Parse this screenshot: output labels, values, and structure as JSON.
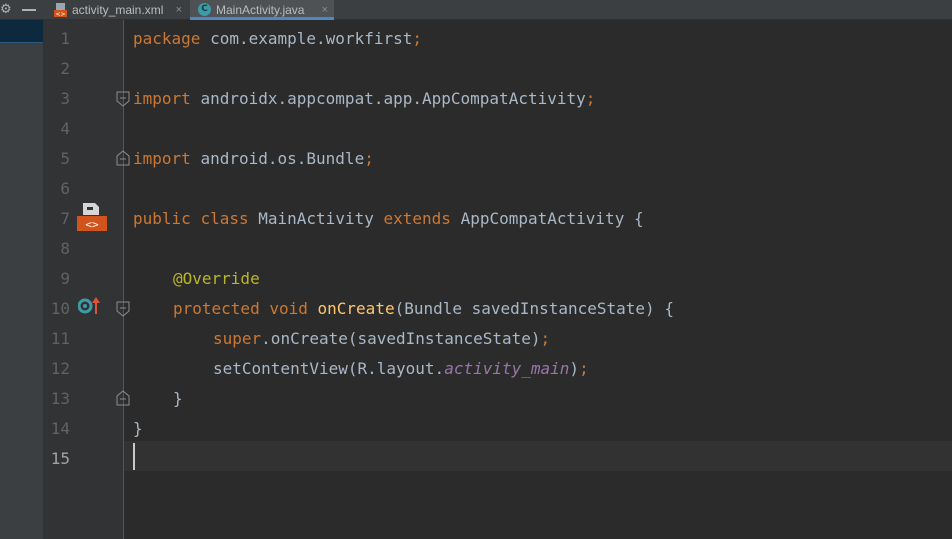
{
  "tabs": [
    {
      "label": "activity_main.xml",
      "icon": "xml-layout-file-icon",
      "active": false
    },
    {
      "label": "MainActivity.java",
      "icon": "java-class-file-icon",
      "active": true
    }
  ],
  "tab_close_glyph": "×",
  "line_numbers": [
    "1",
    "2",
    "3",
    "4",
    "5",
    "6",
    "7",
    "8",
    "9",
    "10",
    "11",
    "12",
    "13",
    "14",
    "15"
  ],
  "current_line": 15,
  "code": {
    "l1": {
      "kw": "package",
      "rest": "com.example.workfirst",
      "semi": ";"
    },
    "l3": {
      "kw": "import",
      "rest": "androidx.appcompat.app.AppCompatActivity",
      "semi": ";"
    },
    "l5": {
      "kw": "import",
      "rest": "android.os.Bundle",
      "semi": ";"
    },
    "l7": {
      "kw1": "public",
      "kw2": "class",
      "name": "MainActivity",
      "kw3": "extends",
      "parent": "AppCompatActivity",
      "brace": "{"
    },
    "l9": {
      "annotation": "@Override"
    },
    "l10": {
      "kw1": "protected",
      "kw2": "void",
      "method": "onCreate",
      "params": "(Bundle savedInstanceState)",
      "brace": "{"
    },
    "l11": {
      "kw": "super",
      "call": ".onCreate(savedInstanceState)",
      "semi": ";"
    },
    "l12": {
      "call": "setContentView(R.layout.",
      "field": "activity_main",
      "close": ")",
      "semi": ";"
    },
    "l13": {
      "brace": "}"
    },
    "l14": {
      "brace": "}"
    }
  },
  "colors": {
    "background": "#2b2b2b",
    "keyword": "#cc7832",
    "annotation": "#bbb529",
    "method": "#ffc66d",
    "field": "#9876aa",
    "text": "#a9b7c6",
    "line_number": "#606366"
  },
  "gutter_icons": [
    {
      "line": 7,
      "icon": "layout-editor-icon"
    },
    {
      "line": 10,
      "icon": "override-method-icon"
    }
  ]
}
